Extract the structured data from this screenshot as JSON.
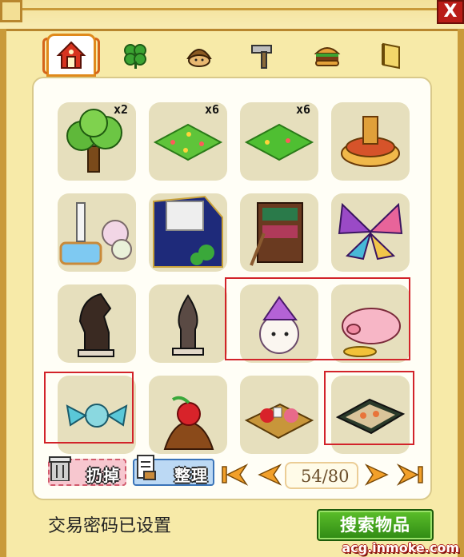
{
  "window": {
    "close_label": "X"
  },
  "tabs": [
    {
      "name": "furniture",
      "icon": "house-icon",
      "active": true
    },
    {
      "name": "plants",
      "icon": "clover-icon",
      "active": false
    },
    {
      "name": "character",
      "icon": "chestnut-icon",
      "active": false
    },
    {
      "name": "tools",
      "icon": "hammer-icon",
      "active": false
    },
    {
      "name": "food",
      "icon": "burger-icon",
      "active": false
    },
    {
      "name": "books",
      "icon": "scroll-icon",
      "active": false
    }
  ],
  "items": [
    {
      "icon": "tree-icon",
      "qty": "x2"
    },
    {
      "icon": "flower-grass-tile-icon",
      "qty": "x6"
    },
    {
      "icon": "grass-tile-icon",
      "qty": "x6"
    },
    {
      "icon": "hotpot-icon",
      "qty": ""
    },
    {
      "icon": "fountain-icon",
      "qty": ""
    },
    {
      "icon": "window-stage-icon",
      "qty": ""
    },
    {
      "icon": "bookshelf-icon",
      "qty": ""
    },
    {
      "icon": "butterfly-icon",
      "qty": ""
    },
    {
      "icon": "chess-knight-icon",
      "qty": ""
    },
    {
      "icon": "chess-bishop-icon",
      "qty": ""
    },
    {
      "icon": "bunny-hat-icon",
      "qty": ""
    },
    {
      "icon": "pig-icon",
      "qty": ""
    },
    {
      "icon": "candy-icon",
      "qty": ""
    },
    {
      "icon": "cherry-cake-icon",
      "qty": ""
    },
    {
      "icon": "food-tray-icon",
      "qty": ""
    },
    {
      "icon": "sushi-plate-icon",
      "qty": ""
    }
  ],
  "toolbar": {
    "discard_label": "扔掉",
    "sort_label": "整理",
    "page_current": "54",
    "page_total": "80",
    "page_display": "54/80"
  },
  "footer": {
    "status_text": "交易密码已设置",
    "search_button": "搜索物品"
  },
  "watermark": "acg.inmoke.com",
  "colors": {
    "active_tab_border": "#e08a1c",
    "highlight_border": "#d2232a",
    "search_button": "#3a9a1a",
    "close_button": "#b91c17"
  }
}
